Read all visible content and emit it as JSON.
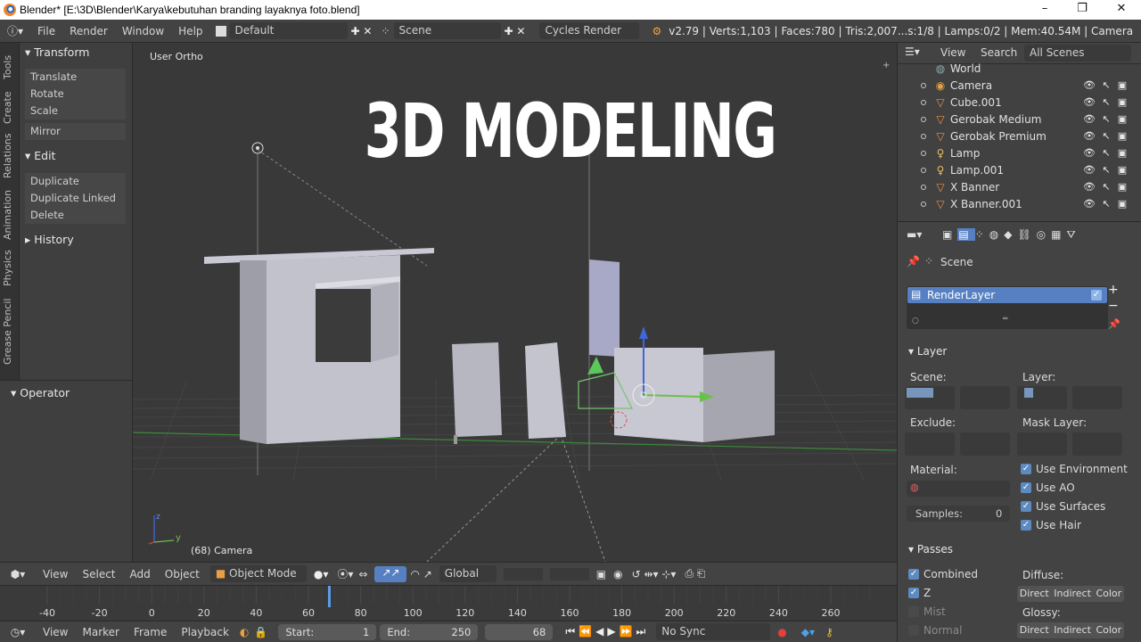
{
  "window": {
    "title": "Blender* [E:\\3D\\Blender\\Karya\\kebutuhan branding layaknya foto.blend]",
    "minimize": "–",
    "maximize": "❐",
    "close": "✕"
  },
  "info_header": {
    "menus": [
      "File",
      "Render",
      "Window",
      "Help"
    ],
    "layout": "Default",
    "scene": "Scene",
    "engine": "Cycles Render",
    "stats": "v2.79 | Verts:1,103 | Faces:780 | Tris:2,007...s:1/8 | Lamps:0/2 | Mem:40.54M | Camera"
  },
  "tool_tabs": [
    "Tools",
    "Create",
    "Relations",
    "Animation",
    "Physics",
    "Grease Pencil"
  ],
  "toolshelf": {
    "transform_header": "Transform",
    "transform_tools": [
      "Translate",
      "Rotate",
      "Scale"
    ],
    "mirror": "Mirror",
    "edit_header": "Edit",
    "edit_tools": [
      "Duplicate",
      "Duplicate Linked",
      "Delete"
    ],
    "history_header": "History",
    "operator_header": "Operator"
  },
  "viewport": {
    "view_name": "User Ortho",
    "overlay_title": "3D MODELING",
    "object_label": "(68) Camera",
    "axis_y": "y",
    "axis_z": "z"
  },
  "view3d_header": {
    "menus": [
      "View",
      "Select",
      "Add",
      "Object"
    ],
    "mode": "Object Mode",
    "orientation": "Global"
  },
  "timeline": {
    "ticks": [
      "-40",
      "-20",
      "0",
      "20",
      "40",
      "60",
      "80",
      "100",
      "120",
      "140",
      "160",
      "180",
      "200",
      "220",
      "240",
      "260"
    ],
    "current_frame_marker": 68
  },
  "timeline_footer": {
    "menus": [
      "View",
      "Marker",
      "Frame",
      "Playback"
    ],
    "start_label": "Start:",
    "start_value": "1",
    "end_label": "End:",
    "end_value": "250",
    "current": "68",
    "sync": "No Sync"
  },
  "outliner": {
    "menus": [
      "View",
      "Search"
    ],
    "filter": "All Scenes",
    "items": [
      {
        "name": "World",
        "icon": "world-icon"
      },
      {
        "name": "Camera",
        "icon": "camera-icon"
      },
      {
        "name": "Cube.001",
        "icon": "mesh-icon"
      },
      {
        "name": "Gerobak Medium",
        "icon": "mesh-icon"
      },
      {
        "name": "Gerobak Premium",
        "icon": "mesh-icon"
      },
      {
        "name": "Lamp",
        "icon": "lamp-icon"
      },
      {
        "name": "Lamp.001",
        "icon": "lamp-icon"
      },
      {
        "name": "X Banner",
        "icon": "mesh-icon"
      },
      {
        "name": "X Banner.001",
        "icon": "mesh-icon"
      }
    ]
  },
  "properties": {
    "context": "Scene",
    "render_layer": "RenderLayer",
    "layer_header": "Layer",
    "scene_label": "Scene:",
    "layer_label": "Layer:",
    "exclude_label": "Exclude:",
    "mask_layer_label": "Mask Layer:",
    "material_label": "Material:",
    "samples_label": "Samples:",
    "samples_value": "0",
    "use_environment": "Use Environment",
    "use_ao": "Use AO",
    "use_surfaces": "Use Surfaces",
    "use_hair": "Use Hair",
    "passes_header": "Passes",
    "combined": "Combined",
    "z": "Z",
    "mist": "Mist",
    "normal": "Normal",
    "diffuse_label": "Diffuse:",
    "glossy_label": "Glossy:",
    "direct": "Direct",
    "indirect": "Indirect",
    "color": "Color"
  },
  "colors": {
    "accent": "#5680c2",
    "background": "#393939",
    "panel": "#434343"
  }
}
